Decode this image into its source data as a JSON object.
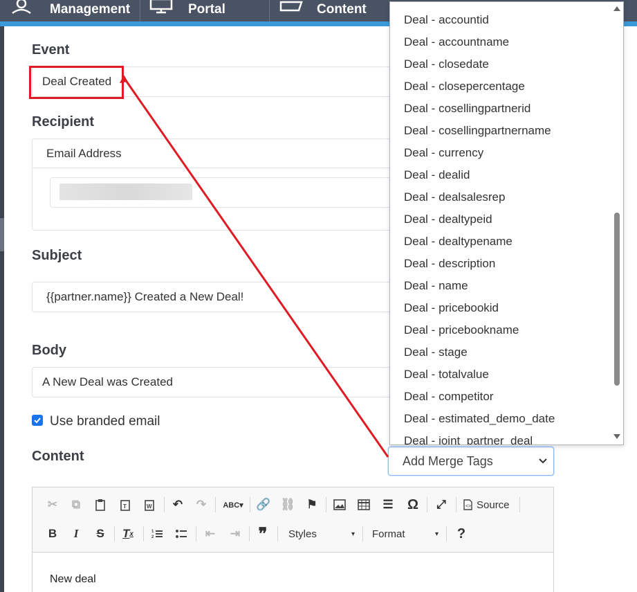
{
  "nav": {
    "items": [
      "Management",
      "Portal",
      "Content"
    ]
  },
  "form": {
    "event_label": "Event",
    "event_value": "Deal Created",
    "recipient_label": "Recipient",
    "recipient_type": "Email Address",
    "subject_label": "Subject",
    "subject_value": "{{partner.name}} Created a New Deal!",
    "body_label": "Body",
    "body_value": "A New Deal was Created",
    "branded_label": "Use branded email",
    "branded_checked": true,
    "content_label": "Content",
    "merge_tags_value": "Add Merge Tags"
  },
  "editor": {
    "source_label": "Source",
    "styles_label": "Styles",
    "format_label": "Format",
    "body_text": "New deal"
  },
  "merge_tags": [
    "Deal - accountid",
    "Deal - accountname",
    "Deal - closedate",
    "Deal - closepercentage",
    "Deal - cosellingpartnerid",
    "Deal - cosellingpartnername",
    "Deal - currency",
    "Deal - dealid",
    "Deal - dealsalesrep",
    "Deal - dealtypeid",
    "Deal - dealtypename",
    "Deal - description",
    "Deal - name",
    "Deal - pricebookid",
    "Deal - pricebookname",
    "Deal - stage",
    "Deal - totalvalue",
    "Deal - competitor",
    "Deal - estimated_demo_date",
    "Deal - joint_partner_deal"
  ],
  "colors": {
    "nav_bg": "#4a5363",
    "nav_accent": "#3a9ad9",
    "annotation_red": "#e01b24",
    "checkbox_blue": "#1a73e8"
  }
}
